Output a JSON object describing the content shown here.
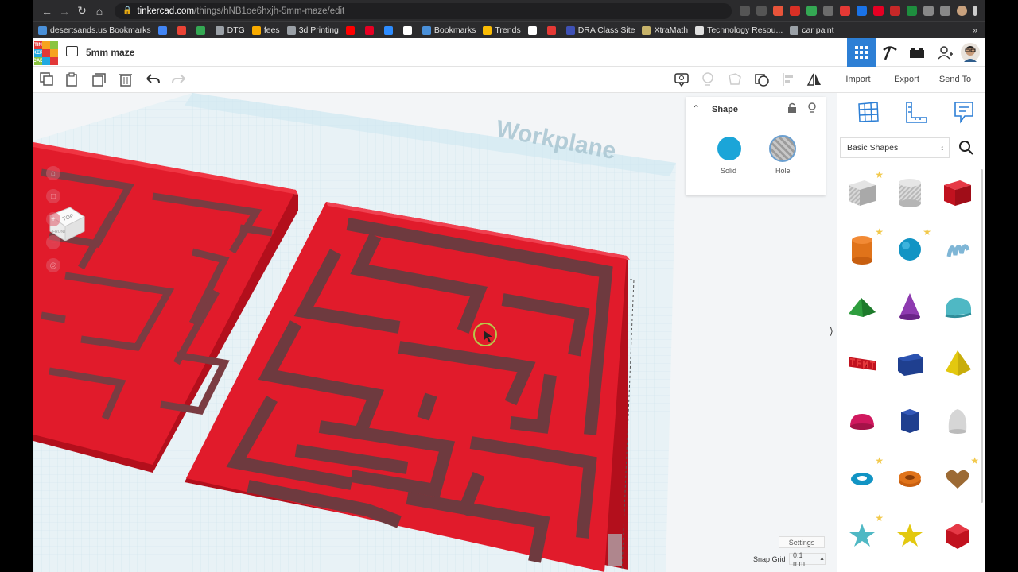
{
  "browser": {
    "url_host": "tinkercad.com",
    "url_path": "/things/hNB1oe6hxjh-5mm-maze/edit",
    "bookmarks": [
      {
        "label": "desertsands.us Bookmarks",
        "color": "#4a90d9"
      },
      {
        "label": "",
        "color": "#4285f4"
      },
      {
        "label": "",
        "color": "#ea4335"
      },
      {
        "label": "",
        "color": "#34a853"
      },
      {
        "label": "DTG",
        "color": "#9aa0a6"
      },
      {
        "label": "fees",
        "color": "#f9ab00"
      },
      {
        "label": "3d Printing",
        "color": "#9aa0a6"
      },
      {
        "label": "",
        "color": "#ff0000"
      },
      {
        "label": "",
        "color": "#e60023"
      },
      {
        "label": "",
        "color": "#2d8cff"
      },
      {
        "label": "",
        "color": "#ffffff"
      },
      {
        "label": "Bookmarks",
        "color": "#4a90d9"
      },
      {
        "label": "Trends",
        "color": "#fbbc04"
      },
      {
        "label": "",
        "color": "#ffffff"
      },
      {
        "label": "",
        "color": "#e53935"
      },
      {
        "label": "DRA Class Site",
        "color": "#3f51b5"
      },
      {
        "label": "XtraMath",
        "color": "#c7b36a"
      },
      {
        "label": "Technology Resou...",
        "color": "#e0e0e0"
      },
      {
        "label": "car paint",
        "color": "#9aa0a6"
      }
    ],
    "more_bookmarks": "»"
  },
  "app": {
    "project_title": "5mm maze",
    "logo_letters": [
      "TIN",
      "KER",
      "CAD"
    ]
  },
  "toolbar": {
    "import_label": "Import",
    "export_label": "Export",
    "sendto_label": "Send To"
  },
  "shape_panel": {
    "title": "Shape",
    "solid_label": "Solid",
    "hole_label": "Hole",
    "solid_color": "#1ba5d8"
  },
  "library": {
    "selected": "Basic Shapes",
    "shapes": [
      {
        "name": "box-hole",
        "starred": true
      },
      {
        "name": "cylinder-hole",
        "starred": false
      },
      {
        "name": "box",
        "starred": false
      },
      {
        "name": "cylinder",
        "starred": true
      },
      {
        "name": "sphere",
        "starred": true
      },
      {
        "name": "scribble",
        "starred": false
      },
      {
        "name": "roof",
        "starred": false
      },
      {
        "name": "cone",
        "starred": false
      },
      {
        "name": "round-roof",
        "starred": false
      },
      {
        "name": "text",
        "starred": false
      },
      {
        "name": "wedge",
        "starred": false
      },
      {
        "name": "pyramid",
        "starred": false
      },
      {
        "name": "half-sphere",
        "starred": false
      },
      {
        "name": "polygon",
        "starred": false
      },
      {
        "name": "paraboloid",
        "starred": false
      },
      {
        "name": "torus",
        "starred": true
      },
      {
        "name": "tube",
        "starred": false
      },
      {
        "name": "heart",
        "starred": true
      },
      {
        "name": "star",
        "starred": true
      },
      {
        "name": "star-yellow",
        "starred": false
      },
      {
        "name": "icosahedron",
        "starred": false
      }
    ]
  },
  "viewport": {
    "workplane_label": "Workplane",
    "viewcube_top": "TOP",
    "viewcube_front": "FRONT",
    "settings_label": "Settings",
    "snap_grid_label": "Snap Grid",
    "snap_grid_value": "0.1 mm"
  }
}
